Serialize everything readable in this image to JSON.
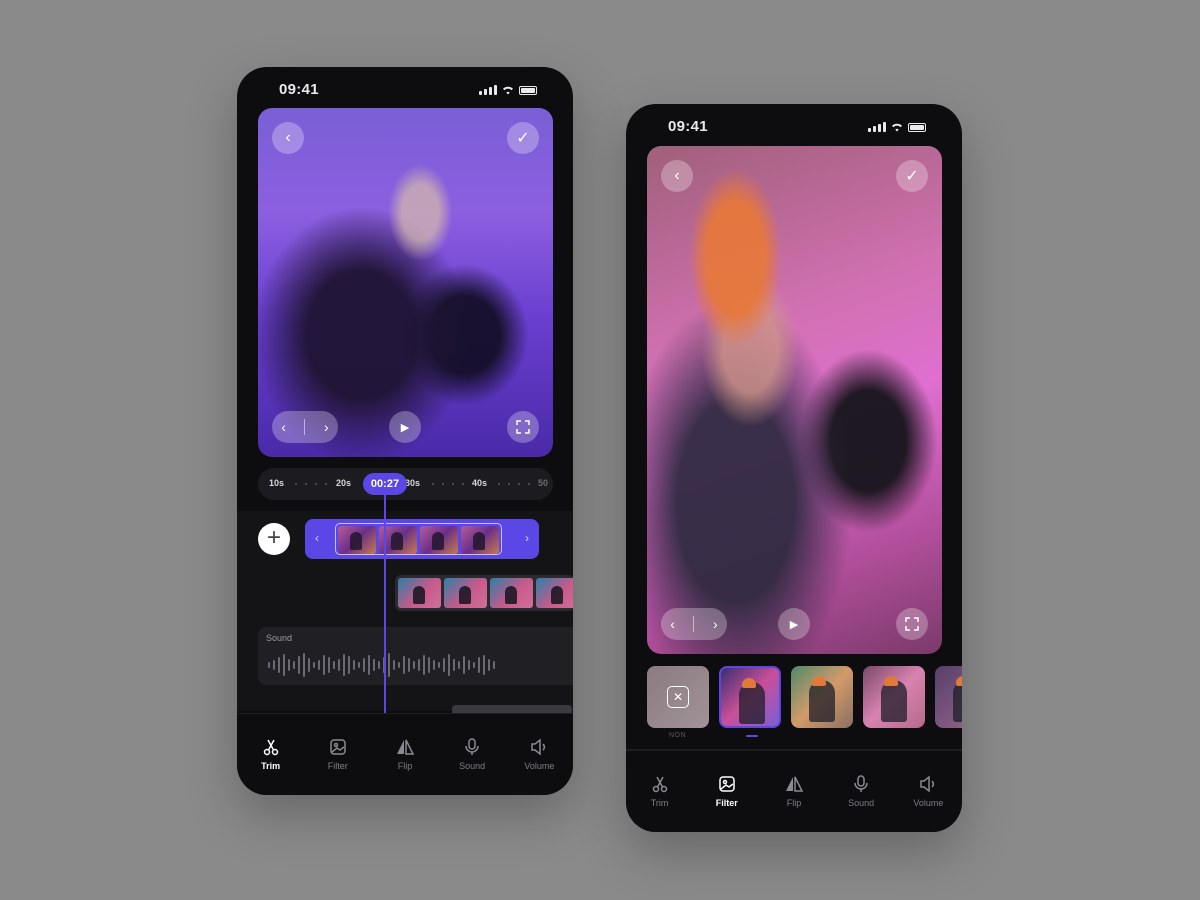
{
  "colors": {
    "accent": "#5b47e6",
    "background": "#8a8a8a",
    "phone": "#0d0d0f"
  },
  "phone_trim": {
    "status_time": "09:41",
    "ruler": {
      "ticks": [
        "10s",
        "20s",
        "30s",
        "40s",
        "50"
      ]
    },
    "playhead_time": "00:27",
    "sound_label": "Sound",
    "tabs": [
      {
        "label": "Trim",
        "icon": "scissors-icon",
        "active": true
      },
      {
        "label": "Filter",
        "icon": "image-icon",
        "active": false
      },
      {
        "label": "Flip",
        "icon": "flip-icon",
        "active": false
      },
      {
        "label": "Sound",
        "icon": "microphone-icon",
        "active": false
      },
      {
        "label": "Volume",
        "icon": "speaker-icon",
        "active": false
      }
    ]
  },
  "phone_filter": {
    "status_time": "09:41",
    "filter_caption": "NON",
    "tabs": [
      {
        "label": "Trim",
        "icon": "scissors-icon",
        "active": false
      },
      {
        "label": "Filter",
        "icon": "image-icon",
        "active": true
      },
      {
        "label": "Flip",
        "icon": "flip-icon",
        "active": false
      },
      {
        "label": "Sound",
        "icon": "microphone-icon",
        "active": false
      },
      {
        "label": "Volume",
        "icon": "speaker-icon",
        "active": false
      }
    ]
  }
}
